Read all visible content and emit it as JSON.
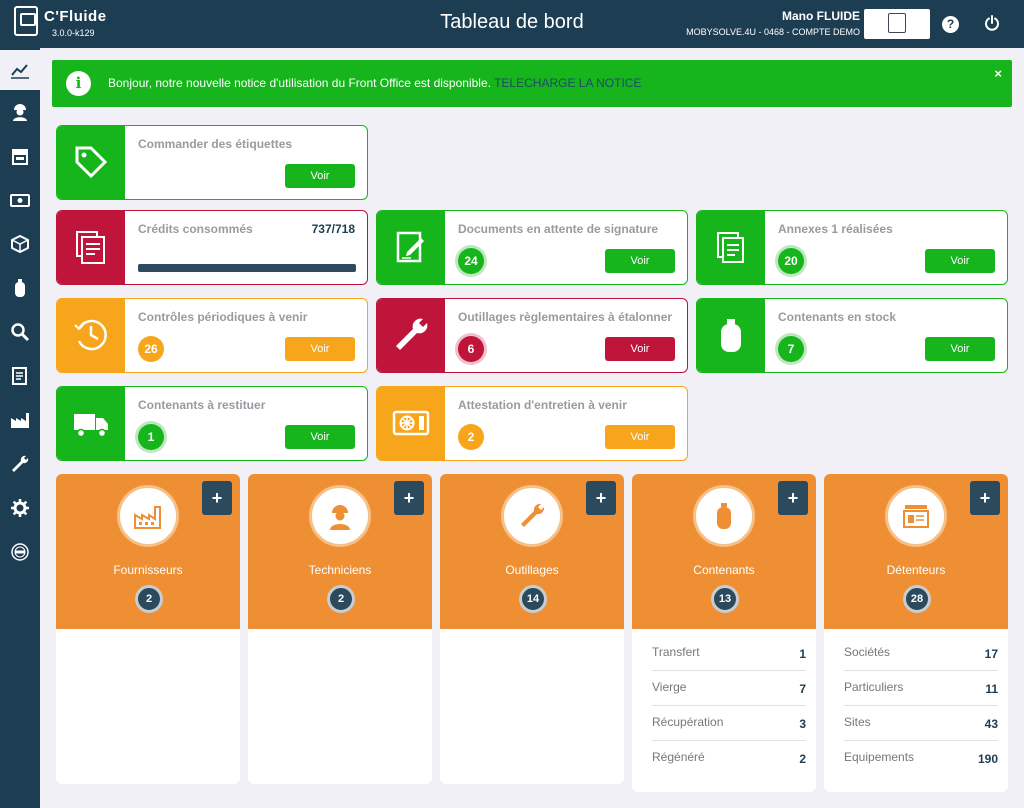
{
  "header": {
    "logo_name": "C'Fluide",
    "version": "3.0.0-k129",
    "title": "Tableau de bord",
    "user_name": "Mano FLUIDE",
    "company": "MOBYSOLVE.4U - 0468 - COMPTE DEMO",
    "help_label": "?"
  },
  "alert": {
    "message": "Bonjour, notre nouvelle notice d'utilisation du Front Office est disponible. ",
    "link": "TELECHARGE LA NOTICE",
    "close": "×",
    "info": "i"
  },
  "colors": {
    "green": "#16b51c",
    "orange": "#f7a51a",
    "red": "#c0153b",
    "navy": "#1d3d52",
    "panel_orange": "#ee8f33"
  },
  "sidebar": {
    "items": [
      {
        "icon": "chart-line-icon"
      },
      {
        "icon": "technician-icon"
      },
      {
        "icon": "storefront-icon"
      },
      {
        "icon": "banknote-icon"
      },
      {
        "icon": "box-icon"
      },
      {
        "icon": "gas-bottle-icon"
      },
      {
        "icon": "search-icon"
      },
      {
        "icon": "document-icon"
      },
      {
        "icon": "factory-icon"
      },
      {
        "icon": "wrench-icon"
      },
      {
        "icon": "gear-icon"
      },
      {
        "icon": "certification-icon"
      }
    ]
  },
  "cards": {
    "etiquettes": {
      "title": "Commander des étiquettes",
      "button": "Voir",
      "icon": "tag-icon"
    },
    "credits": {
      "title": "Crédits consommés",
      "value": "737/718",
      "progress_percent": 100,
      "icon": "documents-icon"
    },
    "documents": {
      "title": "Documents en attente de signature",
      "count": "24",
      "button": "Voir",
      "icon": "sign-icon"
    },
    "annexes": {
      "title": "Annexes 1 réalisées",
      "count": "20",
      "button": "Voir",
      "icon": "annex-icon"
    },
    "controles": {
      "title": "Contrôles périodiques à venir",
      "count": "26",
      "button": "Voir",
      "icon": "clock-icon"
    },
    "outillages": {
      "title": "Outillages règlementaires à étalonner",
      "count": "6",
      "button": "Voir",
      "icon": "wrench-icon"
    },
    "stock": {
      "title": "Contenants en stock",
      "count": "7",
      "button": "Voir",
      "icon": "gas-bottle-icon"
    },
    "restituer": {
      "title": "Contenants à restituer",
      "count": "1",
      "button": "Voir",
      "icon": "truck-icon"
    },
    "attestation": {
      "title": "Attestation d'entretien à venir",
      "count": "2",
      "button": "Voir",
      "icon": "unit-icon"
    }
  },
  "panels": {
    "fournisseurs": {
      "label": "Fournisseurs",
      "count": "2",
      "plus": "+",
      "icon": "factory-icon"
    },
    "techniciens": {
      "label": "Techniciens",
      "count": "2",
      "plus": "+",
      "icon": "technician-icon"
    },
    "outillages": {
      "label": "Outillages",
      "count": "14",
      "plus": "+",
      "icon": "wrench-icon"
    },
    "contenants": {
      "label": "Contenants",
      "count": "13",
      "plus": "+",
      "icon": "gas-bottle-icon",
      "rows": [
        {
          "k": "Transfert",
          "v": "1"
        },
        {
          "k": "Vierge",
          "v": "7"
        },
        {
          "k": "Récupération",
          "v": "3"
        },
        {
          "k": "Régénéré",
          "v": "2"
        }
      ]
    },
    "detenteurs": {
      "label": "Détenteurs",
      "count": "28",
      "plus": "+",
      "icon": "id-card-icon",
      "rows": [
        {
          "k": "Sociétés",
          "v": "17"
        },
        {
          "k": "Particuliers",
          "v": "11"
        },
        {
          "k": "Sites",
          "v": "43"
        },
        {
          "k": "Equipements",
          "v": "190"
        }
      ]
    }
  }
}
